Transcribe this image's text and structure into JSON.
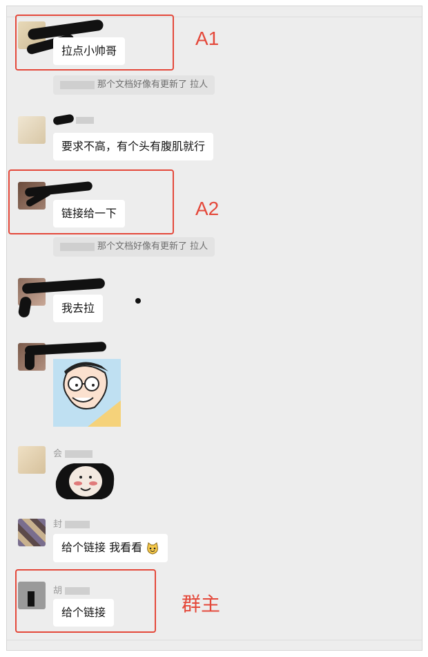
{
  "annotations": {
    "a1": "A1",
    "a2": "A2",
    "owner": "群主"
  },
  "messages": {
    "m1": {
      "text": "拉点小帅哥"
    },
    "sys1": {
      "text": "那个文档好像有更新了 拉人"
    },
    "m2": {
      "text": "要求不高，有个头有腹肌就行"
    },
    "m3": {
      "text": "链接给一下"
    },
    "sys2": {
      "text": "那个文档好像有更新了 拉人"
    },
    "m4": {
      "text": "我去拉"
    },
    "m5": {
      "sticker": "cartoon-boy-glasses-sticker"
    },
    "m6": {
      "name_fragment": "会",
      "sticker": "panda-meme-sticker"
    },
    "m7": {
      "name_fragment": "封",
      "text": "给个链接 我看看",
      "emoji": "cat-face-emoji"
    },
    "m8": {
      "name_fragment": "胡",
      "text": "给个链接"
    }
  },
  "colors": {
    "annotation": "#e4483a",
    "background": "#ededed",
    "bubble": "#ffffff"
  }
}
